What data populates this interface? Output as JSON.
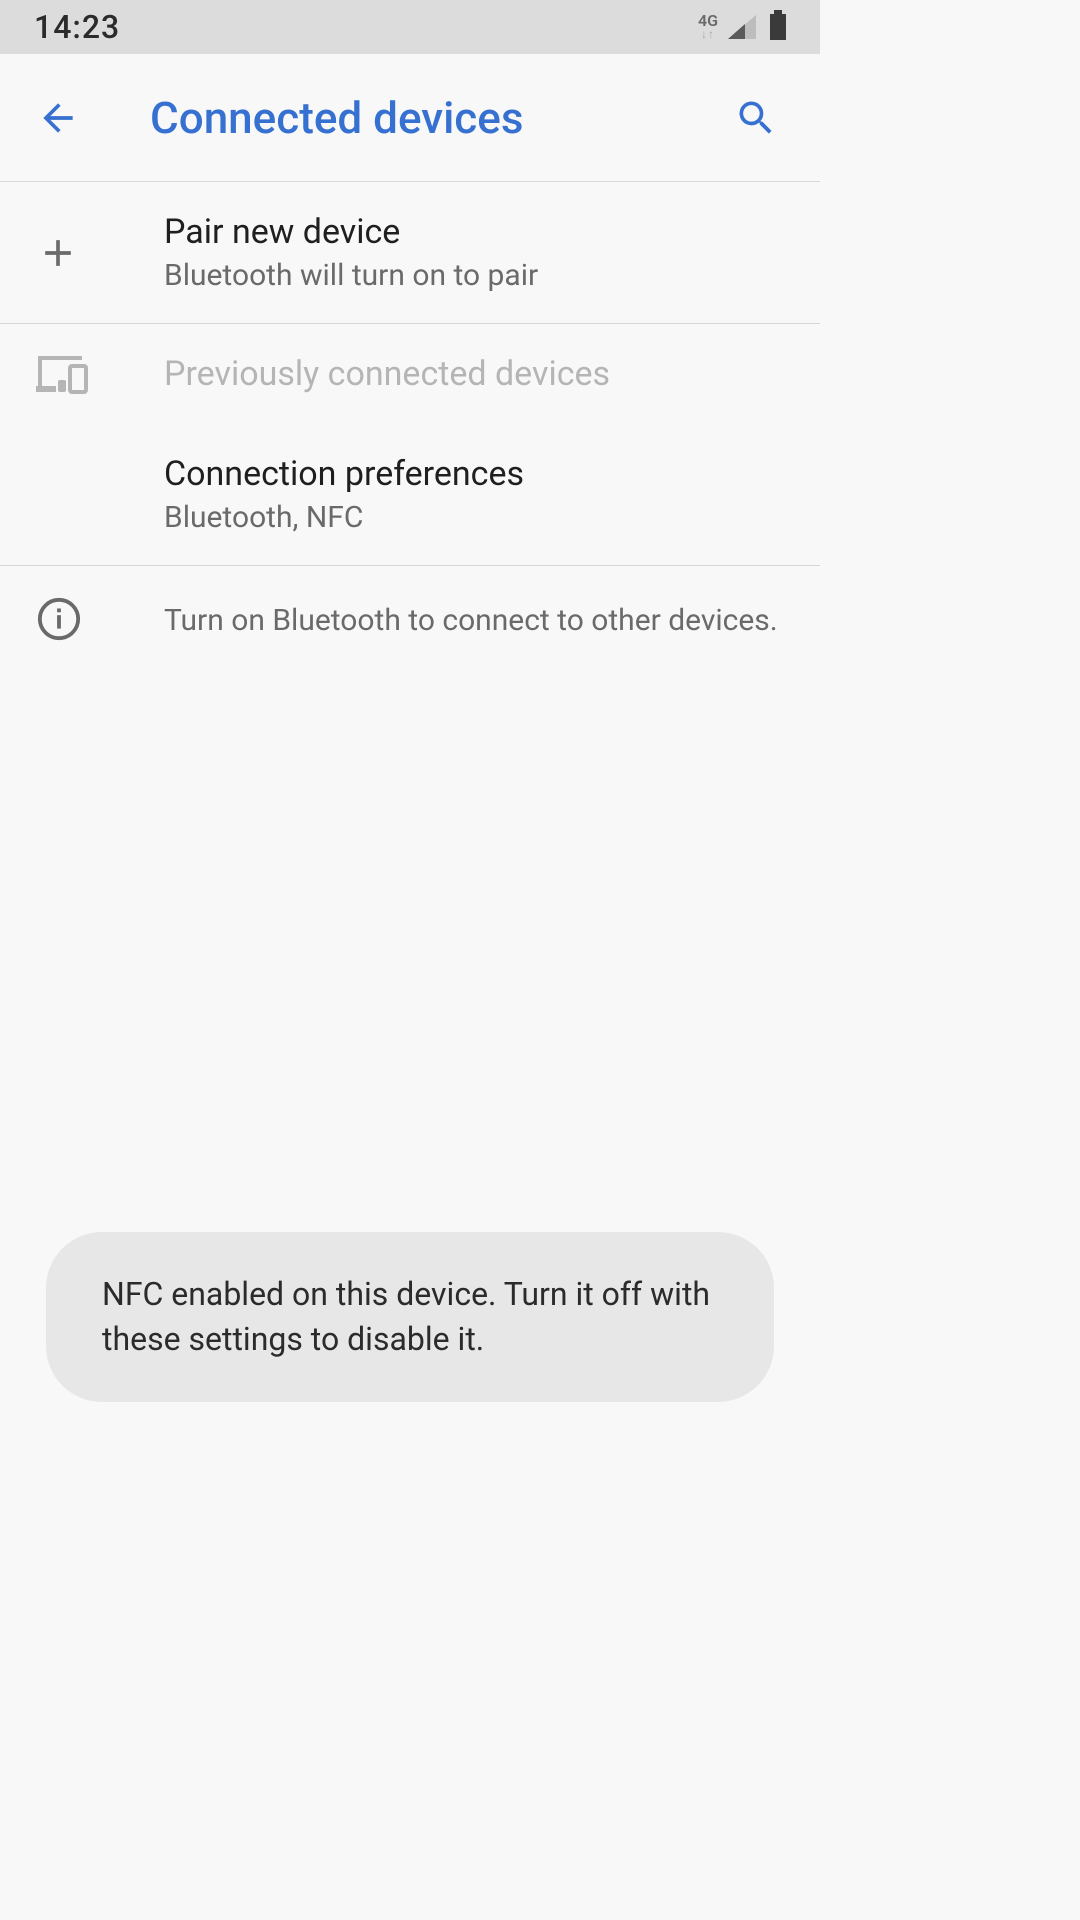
{
  "statusBar": {
    "time": "14:23",
    "network": "4G"
  },
  "appBar": {
    "title": "Connected devices"
  },
  "items": {
    "pair": {
      "title": "Pair new device",
      "subtitle": "Bluetooth will turn on to pair"
    },
    "previous": {
      "title": "Previously connected devices"
    },
    "prefs": {
      "title": "Connection preferences",
      "subtitle": "Bluetooth, NFC"
    },
    "info": {
      "text": "Turn on Bluetooth to connect to other devices."
    }
  },
  "toast": {
    "text": "NFC enabled on this device. Turn it off with these settings to disable it."
  }
}
